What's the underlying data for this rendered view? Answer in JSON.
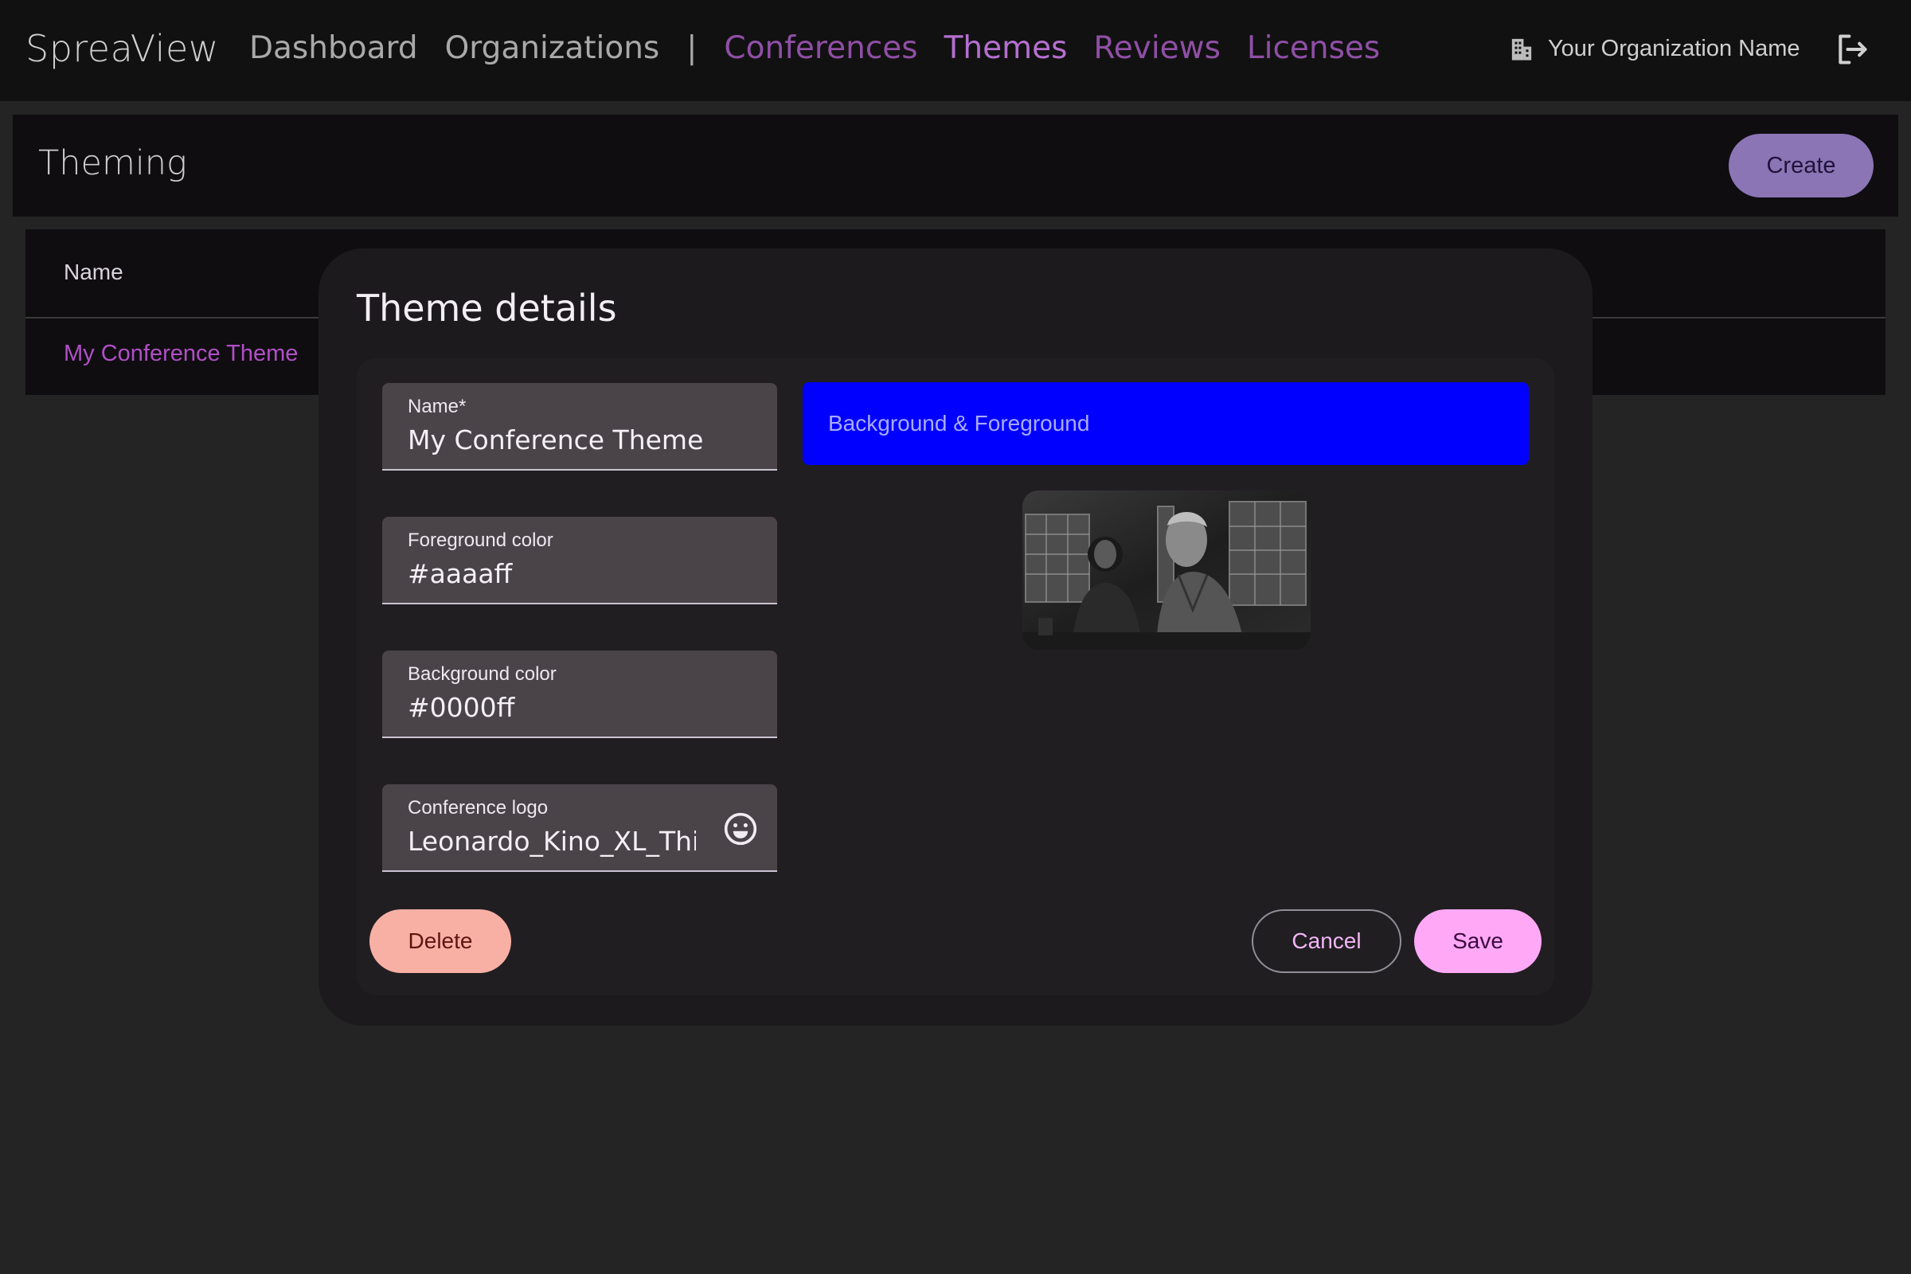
{
  "app": {
    "brand": "SpreaView"
  },
  "nav": {
    "items": [
      {
        "label": "Dashboard"
      },
      {
        "label": "Organizations"
      },
      {
        "label": "|"
      },
      {
        "label": "Conferences"
      },
      {
        "label": "Themes"
      },
      {
        "label": "Reviews"
      },
      {
        "label": "Licenses"
      }
    ],
    "org_name": "Your Organization Name",
    "org_icon": "building-icon",
    "logout_icon": "logout-icon"
  },
  "page": {
    "title": "Theming",
    "create_label": "Create"
  },
  "table": {
    "headers": [
      "Name"
    ],
    "rows": [
      [
        "My Conference Theme"
      ]
    ]
  },
  "dialog": {
    "title": "Theme details",
    "fields": {
      "name": {
        "label": "Name*",
        "value": "My Conference Theme"
      },
      "foreground": {
        "label": "Foreground color",
        "value": "#aaaaff"
      },
      "background": {
        "label": "Background color",
        "value": "#0000ff"
      },
      "logo": {
        "label": "Conference logo",
        "value": "Leonardo_Kino_XL_This",
        "icon": "smiley-icon"
      }
    },
    "preview": {
      "text": "Background & Foreground",
      "bg": "#0000ff",
      "fg": "#aaaaff"
    },
    "buttons": {
      "delete": "Delete",
      "cancel": "Cancel",
      "save": "Save"
    }
  },
  "colors": {
    "accent_purple": "#b56fd0",
    "link_purple": "#b04fc6",
    "create_button": "#8b75b5",
    "delete_button": "#f9b0a4",
    "save_button": "#ffa9f6"
  }
}
